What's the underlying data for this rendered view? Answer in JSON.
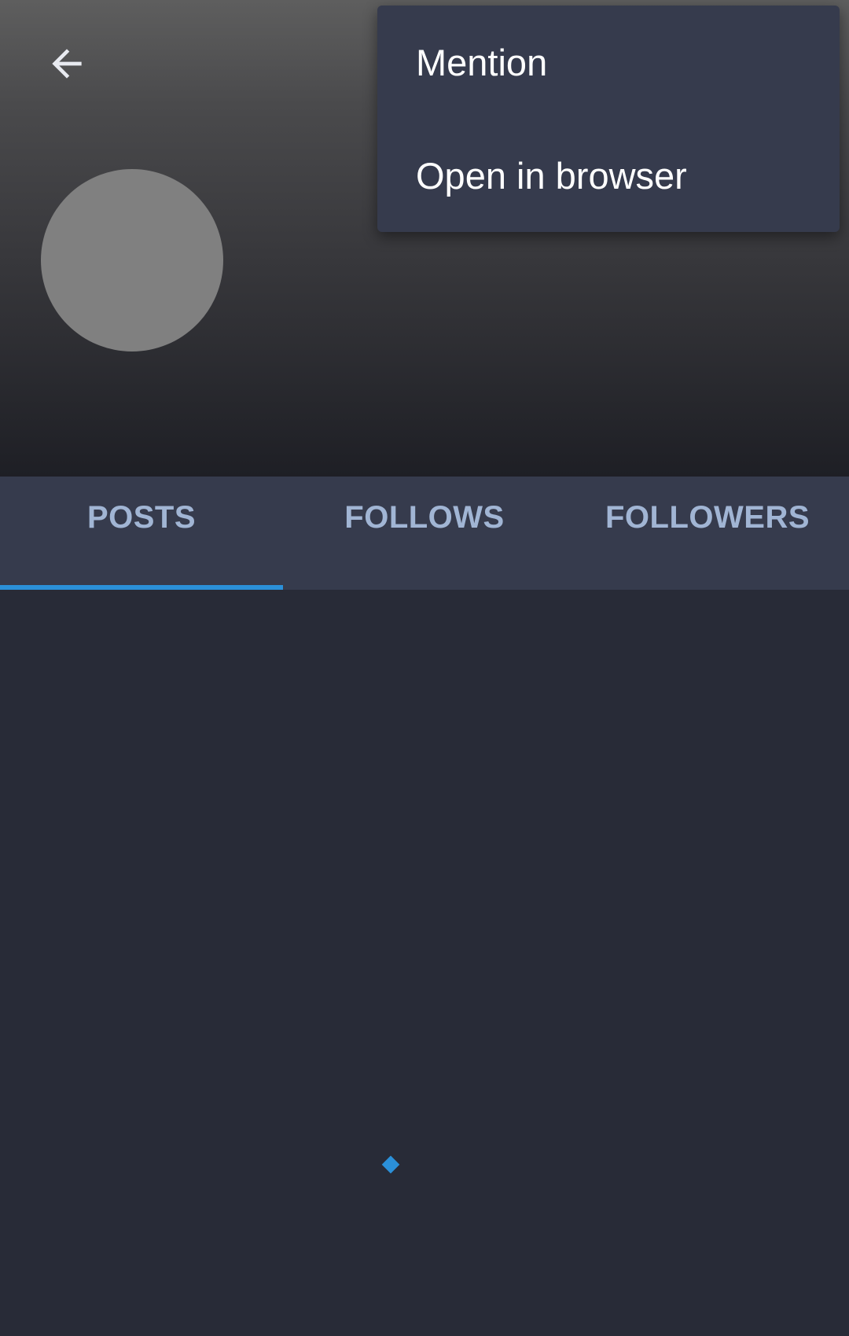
{
  "icons": {
    "back": "arrow-left-icon",
    "loading": "loading-spinner-icon"
  },
  "colors": {
    "accent": "#2b90d9",
    "tab_text": "#a1b5d4",
    "tab_bar": "#363b4d",
    "menu_bg": "#363b4d",
    "background": "#282b37",
    "avatar_placeholder": "#808080"
  },
  "overflow_menu": {
    "items": [
      {
        "label": "Mention"
      },
      {
        "label": "Open in browser"
      }
    ]
  },
  "tabs": [
    {
      "label": "POSTS",
      "selected": true
    },
    {
      "label": "FOLLOWS",
      "selected": false
    },
    {
      "label": "FOLLOWERS",
      "selected": false
    }
  ]
}
